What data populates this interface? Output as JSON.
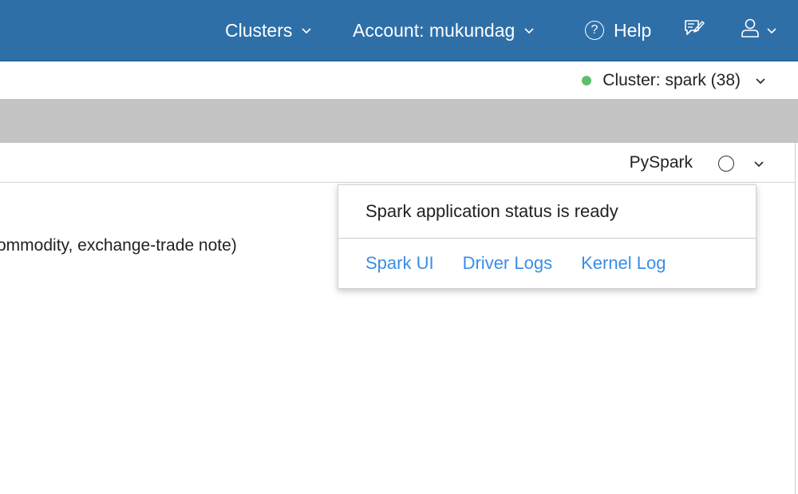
{
  "colors": {
    "nav_background": "#2e6fa8",
    "link": "#3a8ee6",
    "status_ready": "#5cbf6a",
    "band_gray": "#c4c4c4"
  },
  "top_nav": {
    "clusters_label": "Clusters",
    "account_label": "Account: mukundag",
    "help_label": "Help",
    "help_icon": "question-circle-icon",
    "feedback_icon": "feedback-icon",
    "user_icon": "user-icon"
  },
  "cluster_bar": {
    "label": "Cluster: spark (38)",
    "status_icon": "green-dot"
  },
  "kernel": {
    "name": "PySpark",
    "status_icon": "idle-circle-icon"
  },
  "cell": {
    "visible_text": "ommodity, exchange-trade note)"
  },
  "popover": {
    "status_text": "Spark application status is ready",
    "links": [
      {
        "label": "Spark UI"
      },
      {
        "label": "Driver Logs"
      },
      {
        "label": "Kernel Log"
      }
    ]
  }
}
